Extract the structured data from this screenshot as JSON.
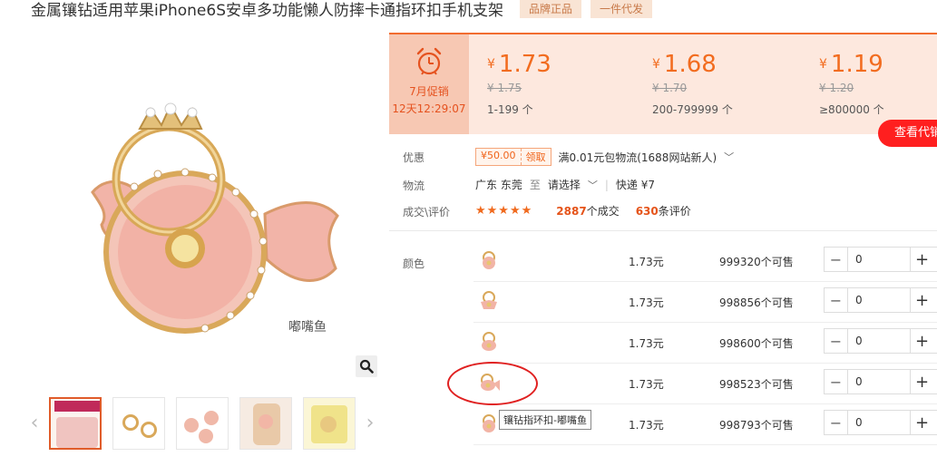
{
  "product": {
    "title": "金属镶钻适用苹果iPhone6S安卓多功能懒人防摔卡通指环扣手机支架",
    "tags": [
      "品牌正品",
      "一件代发"
    ]
  },
  "gallery": {
    "main_caption": "嘟嘴鱼",
    "thumb_count": 5
  },
  "promo": {
    "label": "7月促销",
    "countdown": "12天12:29:07"
  },
  "price_tiers": [
    {
      "symbol": "¥",
      "price": "1.73",
      "old": "¥ 1.75",
      "range": "1-199 个"
    },
    {
      "symbol": "¥",
      "price": "1.68",
      "old": "¥ 1.70",
      "range": "200-799999 个"
    },
    {
      "symbol": "¥",
      "price": "1.19",
      "old": "¥ 1.20",
      "range": "≥800000 个"
    }
  ],
  "quote_button": "查看代销",
  "info": {
    "discount_label": "优惠",
    "coupon_value": "¥50.00",
    "coupon_claim": "领取",
    "discount_text": "满0.01元包物流(1688网站新人)",
    "logistics_label": "物流",
    "logistics_from": "广东 东莞",
    "logistics_to_word": "至",
    "logistics_select": "请选择",
    "logistics_express": "快递 ¥7",
    "deal_label": "成交\\评价",
    "stars": "★★★★★",
    "deal_count": "2887",
    "deal_unit": "个成交",
    "review_count": "630",
    "review_unit": "条评价"
  },
  "sku": {
    "label": "颜色",
    "rows": [
      {
        "price": "1.73元",
        "stock": "999320个可售",
        "qty": "0"
      },
      {
        "price": "1.73元",
        "stock": "998856个可售",
        "qty": "0"
      },
      {
        "price": "1.73元",
        "stock": "998600个可售",
        "qty": "0"
      },
      {
        "price": "1.73元",
        "stock": "998523个可售",
        "qty": "0"
      },
      {
        "price": "1.73元",
        "stock": "998793个可售",
        "qty": "0"
      }
    ],
    "tooltip": "镶钻指环扣-嘟嘴鱼"
  }
}
